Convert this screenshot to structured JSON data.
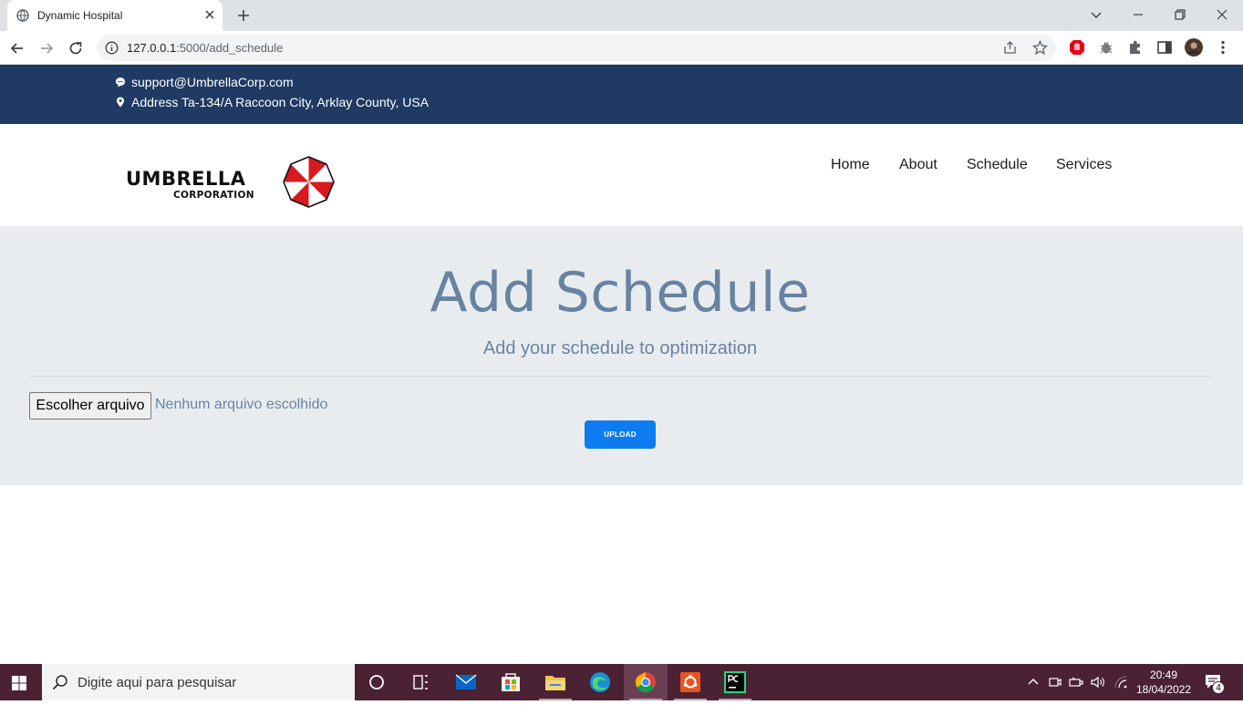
{
  "browser": {
    "tab_title": "Dynamic Hospital",
    "url_host": "127.0.0.1",
    "url_rest": ":5000/add_schedule"
  },
  "topbar": {
    "email": "support@UmbrellaCorp.com",
    "address": "Address Ta-134/A Raccoon City, Arklay County, USA"
  },
  "logo": {
    "line1": "UMBRELLA",
    "line2": "CORPORATION"
  },
  "nav": {
    "items": [
      "Home",
      "About",
      "Schedule",
      "Services"
    ]
  },
  "hero": {
    "title": "Add Schedule",
    "subtitle": "Add your schedule to optimization",
    "file_button": "Escolher arquivo",
    "file_status": "Nenhum arquivo escolhido",
    "upload_button": "UPLOAD"
  },
  "taskbar": {
    "search_placeholder": "Digite aqui para pesquisar",
    "time": "20:49",
    "date": "18/04/2022",
    "notification_count": "4"
  },
  "colors": {
    "topbar": "#1f3a63",
    "hero_bg": "#e9ecef",
    "hero_text": "#6883a2",
    "upload_button": "#0d7cf2",
    "taskbar": "#4a2233"
  }
}
